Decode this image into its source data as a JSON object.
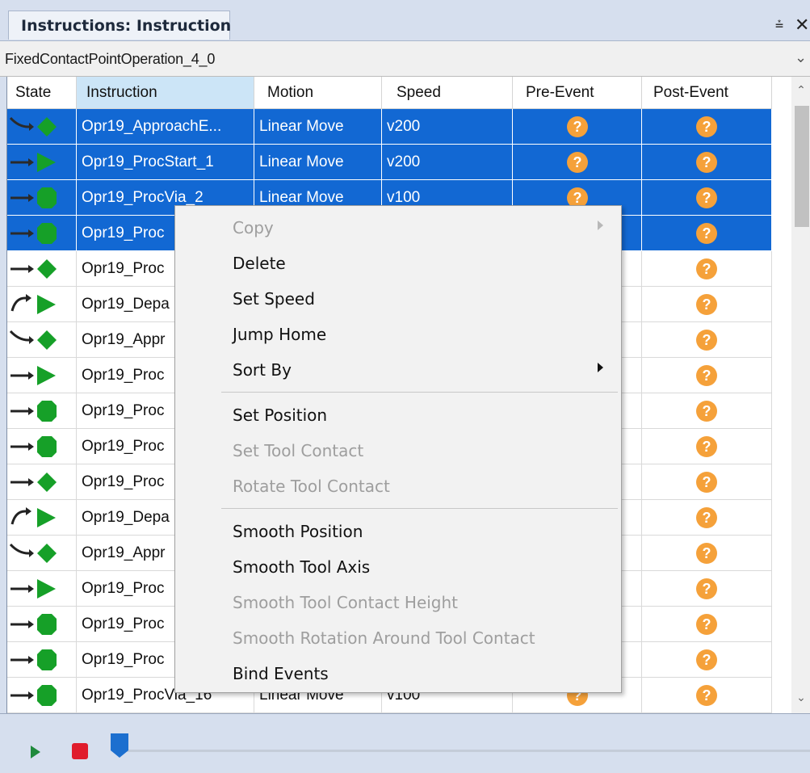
{
  "panel": {
    "tab_title": "Instructions: Instruction",
    "pin_glyph": "⩮",
    "close_glyph": "✕"
  },
  "operation": {
    "selected": "FixedContactPointOperation_4_0"
  },
  "grid": {
    "columns": [
      "State",
      "Instruction",
      "Motion",
      "Speed",
      "Pre-Event",
      "Post-Event"
    ],
    "rows": [
      {
        "state_icon": "approach-diamond-icon",
        "instruction": "Opr19_ApproachE...",
        "motion": "Linear Move",
        "speed": "v200",
        "pre_event": "?",
        "post_event": "?",
        "selected": true
      },
      {
        "state_icon": "start-triangle-icon",
        "instruction": "Opr19_ProcStart_1",
        "motion": "Linear Move",
        "speed": "v200",
        "pre_event": "?",
        "post_event": "?",
        "selected": true
      },
      {
        "state_icon": "via-octagon-icon",
        "instruction": "Opr19_ProcVia_2",
        "motion": "Linear Move",
        "speed": "v100",
        "pre_event": "?",
        "post_event": "?",
        "selected": true
      },
      {
        "state_icon": "via-octagon-icon",
        "instruction": "Opr19_Proc",
        "motion": "",
        "speed": "",
        "pre_event": "",
        "post_event": "?",
        "selected": true
      },
      {
        "state_icon": "end-diamond-icon",
        "instruction": "Opr19_Proc",
        "motion": "",
        "speed": "",
        "pre_event": "",
        "post_event": "?",
        "selected": false
      },
      {
        "state_icon": "depart-triangle-icon",
        "instruction": "Opr19_Depa",
        "motion": "",
        "speed": "",
        "pre_event": "",
        "post_event": "?",
        "selected": false
      },
      {
        "state_icon": "approach-diamond-icon",
        "instruction": "Opr19_Appr",
        "motion": "",
        "speed": "",
        "pre_event": "",
        "post_event": "?",
        "selected": false
      },
      {
        "state_icon": "start-triangle-icon",
        "instruction": "Opr19_Proc",
        "motion": "",
        "speed": "",
        "pre_event": "",
        "post_event": "?",
        "selected": false
      },
      {
        "state_icon": "via-octagon-icon",
        "instruction": "Opr19_Proc",
        "motion": "",
        "speed": "",
        "pre_event": "",
        "post_event": "?",
        "selected": false
      },
      {
        "state_icon": "via-octagon-icon",
        "instruction": "Opr19_Proc",
        "motion": "",
        "speed": "",
        "pre_event": "",
        "post_event": "?",
        "selected": false
      },
      {
        "state_icon": "end-diamond-icon",
        "instruction": "Opr19_Proc",
        "motion": "",
        "speed": "",
        "pre_event": "",
        "post_event": "?",
        "selected": false
      },
      {
        "state_icon": "depart-triangle-icon",
        "instruction": "Opr19_Depa",
        "motion": "",
        "speed": "",
        "pre_event": "",
        "post_event": "?",
        "selected": false
      },
      {
        "state_icon": "approach-diamond-icon",
        "instruction": "Opr19_Appr",
        "motion": "",
        "speed": "",
        "pre_event": "",
        "post_event": "?",
        "selected": false
      },
      {
        "state_icon": "start-triangle-icon",
        "instruction": "Opr19_Proc",
        "motion": "",
        "speed": "",
        "pre_event": "",
        "post_event": "?",
        "selected": false
      },
      {
        "state_icon": "via-octagon-icon",
        "instruction": "Opr19_Proc",
        "motion": "",
        "speed": "",
        "pre_event": "",
        "post_event": "?",
        "selected": false
      },
      {
        "state_icon": "via-octagon-icon",
        "instruction": "Opr19_Proc",
        "motion": "",
        "speed": "",
        "pre_event": "",
        "post_event": "?",
        "selected": false
      },
      {
        "state_icon": "via-octagon-icon",
        "instruction": "Opr19_ProcVia_16",
        "motion": "Linear Move",
        "speed": "v100",
        "pre_event": "?",
        "post_event": "?",
        "selected": false
      }
    ]
  },
  "context_menu": {
    "items": [
      {
        "label": "Copy",
        "enabled": false,
        "submenu": true
      },
      {
        "label": "Delete",
        "enabled": true,
        "submenu": false
      },
      {
        "label": "Set Speed",
        "enabled": true,
        "submenu": false
      },
      {
        "label": "Jump Home",
        "enabled": true,
        "submenu": false
      },
      {
        "label": "Sort By",
        "enabled": true,
        "submenu": true
      },
      {
        "separator": true
      },
      {
        "label": "Set Position",
        "enabled": true,
        "submenu": false
      },
      {
        "label": "Set Tool Contact",
        "enabled": false,
        "submenu": false
      },
      {
        "label": "Rotate Tool Contact",
        "enabled": false,
        "submenu": false
      },
      {
        "separator": true
      },
      {
        "label": "Smooth Position",
        "enabled": true,
        "submenu": false
      },
      {
        "label": "Smooth Tool Axis",
        "enabled": true,
        "submenu": false
      },
      {
        "label": "Smooth Tool Contact Height",
        "enabled": false,
        "submenu": false
      },
      {
        "label": "Smooth Rotation Around Tool Contact",
        "enabled": false,
        "submenu": false
      },
      {
        "label": "Bind Events",
        "enabled": true,
        "submenu": false
      }
    ]
  },
  "playback": {
    "play_icon": "play-icon",
    "stop_icon": "stop-icon",
    "position": 0
  },
  "colors": {
    "selection": "#1268d3",
    "event_badge": "#f5a13a",
    "state_green": "#16a028",
    "play": "#1f8a3c",
    "stop": "#e01c2c",
    "slider_thumb": "#1c6fcf"
  }
}
